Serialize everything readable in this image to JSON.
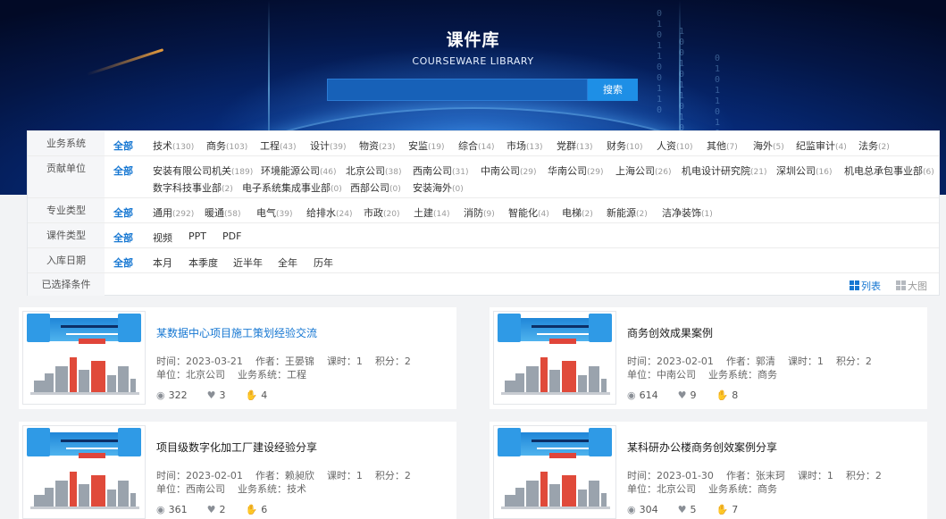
{
  "banner": {
    "title": "课件库",
    "subtitle": "COURSEWARE LIBRARY",
    "search_placeholder": "",
    "search_button": "搜索"
  },
  "filters": {
    "business": {
      "label": "业务系统",
      "options": [
        {
          "name": "全部",
          "count": ""
        },
        {
          "name": "技术",
          "count": "(130)"
        },
        {
          "name": "商务",
          "count": "(103)"
        },
        {
          "name": "工程",
          "count": "(43)"
        },
        {
          "name": "设计",
          "count": "(39)"
        },
        {
          "name": "物资",
          "count": "(23)"
        },
        {
          "name": "安监",
          "count": "(19)"
        },
        {
          "name": "综合",
          "count": "(14)"
        },
        {
          "name": "市场",
          "count": "(13)"
        },
        {
          "name": "党群",
          "count": "(13)"
        },
        {
          "name": "财务",
          "count": "(10)"
        },
        {
          "name": "人资",
          "count": "(10)"
        },
        {
          "name": "其他",
          "count": "(7)"
        },
        {
          "name": "海外",
          "count": "(5)"
        },
        {
          "name": "纪监审计",
          "count": "(4)"
        },
        {
          "name": "法务",
          "count": "(2)"
        }
      ]
    },
    "unit": {
      "label": "贡献单位",
      "options": [
        {
          "name": "全部",
          "count": ""
        },
        {
          "name": "安装有限公司机关",
          "count": "(189)"
        },
        {
          "name": "环境能源公司",
          "count": "(46)"
        },
        {
          "name": "北京公司",
          "count": "(38)"
        },
        {
          "name": "西南公司",
          "count": "(31)"
        },
        {
          "name": "中南公司",
          "count": "(29)"
        },
        {
          "name": "华南公司",
          "count": "(29)"
        },
        {
          "name": "上海公司",
          "count": "(26)"
        },
        {
          "name": "机电设计研究院",
          "count": "(21)"
        },
        {
          "name": "深圳公司",
          "count": "(16)"
        },
        {
          "name": "机电总承包事业部",
          "count": "(6)"
        },
        {
          "name": "数字科技事业部",
          "count": "(2)"
        },
        {
          "name": "电子系统集成事业部",
          "count": "(0)"
        },
        {
          "name": "西部公司",
          "count": "(0)"
        },
        {
          "name": "安装海外",
          "count": "(0)"
        }
      ]
    },
    "specialty": {
      "label": "专业类型",
      "options": [
        {
          "name": "全部",
          "count": ""
        },
        {
          "name": "通用",
          "count": "(292)"
        },
        {
          "name": "暖通",
          "count": "(58)"
        },
        {
          "name": "电气",
          "count": "(39)"
        },
        {
          "name": "给排水",
          "count": "(24)"
        },
        {
          "name": "市政",
          "count": "(20)"
        },
        {
          "name": "土建",
          "count": "(14)"
        },
        {
          "name": "消防",
          "count": "(9)"
        },
        {
          "name": "智能化",
          "count": "(4)"
        },
        {
          "name": "电梯",
          "count": "(2)"
        },
        {
          "name": "新能源",
          "count": "(2)"
        },
        {
          "name": "洁净装饰",
          "count": "(1)"
        }
      ]
    },
    "type": {
      "label": "课件类型",
      "options": [
        {
          "name": "全部",
          "count": ""
        },
        {
          "name": "视频",
          "count": ""
        },
        {
          "name": "PPT",
          "count": ""
        },
        {
          "name": "PDF",
          "count": ""
        }
      ]
    },
    "date": {
      "label": "入库日期",
      "options": [
        {
          "name": "全部",
          "count": ""
        },
        {
          "name": "本月",
          "count": ""
        },
        {
          "name": "本季度",
          "count": ""
        },
        {
          "name": "近半年",
          "count": ""
        },
        {
          "name": "全年",
          "count": ""
        },
        {
          "name": "历年",
          "count": ""
        }
      ]
    },
    "selected": {
      "label": "已选择条件",
      "view_list": "列表",
      "view_grid": "大图"
    }
  },
  "colors": {
    "accent": "#1677d2",
    "banner_dark": "#041646",
    "search_button": "#1e8fe6"
  },
  "cards": [
    {
      "title": "某数据中心项目施工策划经验交流",
      "time": "时间：2023-03-21",
      "author": "作者：王晏锦",
      "hours": "课时：1",
      "points": "积分：2",
      "unit": "单位：北京公司",
      "system": "业务系统：工程",
      "views": "322",
      "likes": "3",
      "thumbs": "4"
    },
    {
      "title": "商务创效成果案例",
      "time": "时间：2023-02-01",
      "author": "作者：郭清",
      "hours": "课时：1",
      "points": "积分：2",
      "unit": "单位：中南公司",
      "system": "业务系统：商务",
      "views": "614",
      "likes": "9",
      "thumbs": "8"
    },
    {
      "title": "项目级数字化加工厂建设经验分享",
      "time": "时间：2023-02-01",
      "author": "作者：赖昶欣",
      "hours": "课时：1",
      "points": "积分：2",
      "unit": "单位：西南公司",
      "system": "业务系统：技术",
      "views": "361",
      "likes": "2",
      "thumbs": "6"
    },
    {
      "title": "某科研办公楼商务创效案例分享",
      "time": "时间：2023-01-30",
      "author": "作者：张末珂",
      "hours": "课时：1",
      "points": "积分：2",
      "unit": "单位：北京公司",
      "system": "业务系统：商务",
      "views": "304",
      "likes": "5",
      "thumbs": "7"
    }
  ]
}
